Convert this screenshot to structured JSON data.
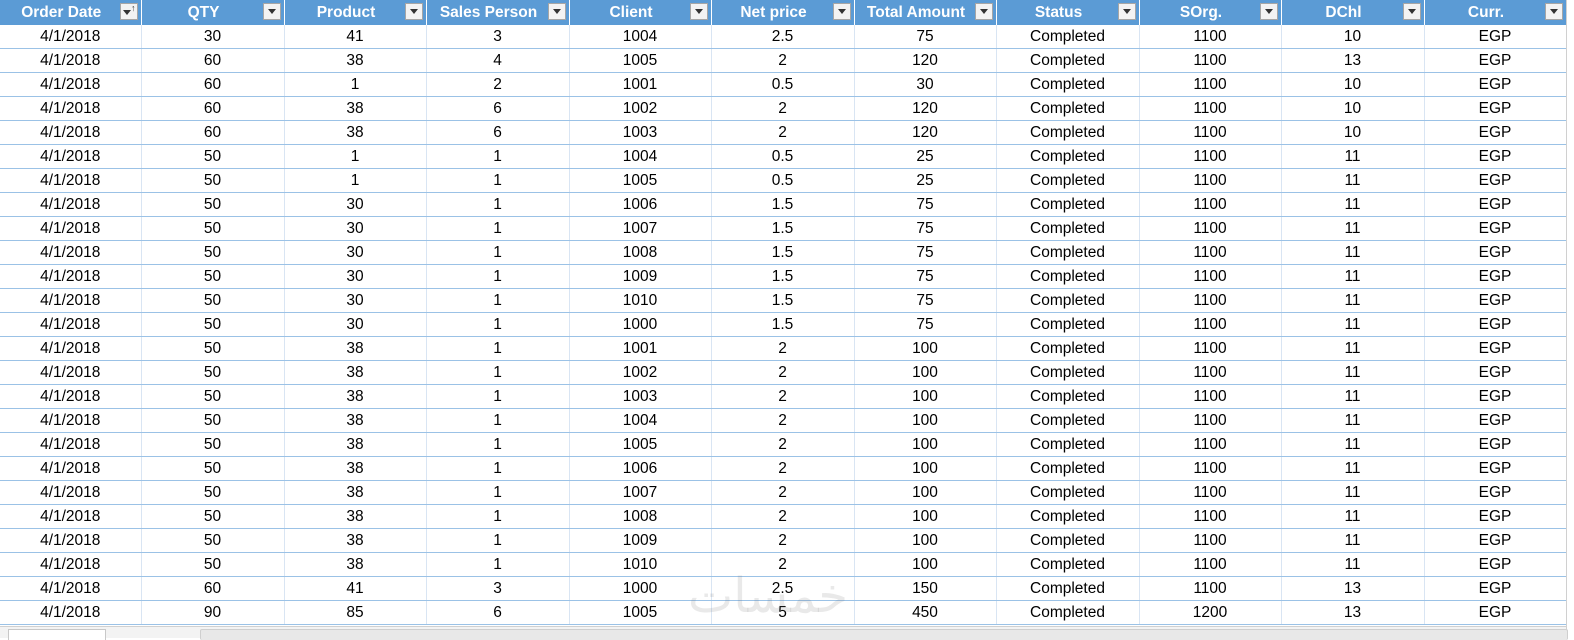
{
  "table": {
    "columns": [
      {
        "label": "Order Date",
        "sorted": true
      },
      {
        "label": "QTY"
      },
      {
        "label": "Product"
      },
      {
        "label": "Sales Person"
      },
      {
        "label": "Client"
      },
      {
        "label": "Net price"
      },
      {
        "label": "Total  Amount"
      },
      {
        "label": "Status"
      },
      {
        "label": "SOrg."
      },
      {
        "label": "DChl"
      },
      {
        "label": "Curr."
      }
    ],
    "rows": [
      [
        "4/1/2018",
        "30",
        "41",
        "3",
        "1004",
        "2.5",
        "75",
        "Completed",
        "1100",
        "10",
        "EGP"
      ],
      [
        "4/1/2018",
        "60",
        "38",
        "4",
        "1005",
        "2",
        "120",
        "Completed",
        "1100",
        "13",
        "EGP"
      ],
      [
        "4/1/2018",
        "60",
        "1",
        "2",
        "1001",
        "0.5",
        "30",
        "Completed",
        "1100",
        "10",
        "EGP"
      ],
      [
        "4/1/2018",
        "60",
        "38",
        "6",
        "1002",
        "2",
        "120",
        "Completed",
        "1100",
        "10",
        "EGP"
      ],
      [
        "4/1/2018",
        "60",
        "38",
        "6",
        "1003",
        "2",
        "120",
        "Completed",
        "1100",
        "10",
        "EGP"
      ],
      [
        "4/1/2018",
        "50",
        "1",
        "1",
        "1004",
        "0.5",
        "25",
        "Completed",
        "1100",
        "11",
        "EGP"
      ],
      [
        "4/1/2018",
        "50",
        "1",
        "1",
        "1005",
        "0.5",
        "25",
        "Completed",
        "1100",
        "11",
        "EGP"
      ],
      [
        "4/1/2018",
        "50",
        "30",
        "1",
        "1006",
        "1.5",
        "75",
        "Completed",
        "1100",
        "11",
        "EGP"
      ],
      [
        "4/1/2018",
        "50",
        "30",
        "1",
        "1007",
        "1.5",
        "75",
        "Completed",
        "1100",
        "11",
        "EGP"
      ],
      [
        "4/1/2018",
        "50",
        "30",
        "1",
        "1008",
        "1.5",
        "75",
        "Completed",
        "1100",
        "11",
        "EGP"
      ],
      [
        "4/1/2018",
        "50",
        "30",
        "1",
        "1009",
        "1.5",
        "75",
        "Completed",
        "1100",
        "11",
        "EGP"
      ],
      [
        "4/1/2018",
        "50",
        "30",
        "1",
        "1010",
        "1.5",
        "75",
        "Completed",
        "1100",
        "11",
        "EGP"
      ],
      [
        "4/1/2018",
        "50",
        "30",
        "1",
        "1000",
        "1.5",
        "75",
        "Completed",
        "1100",
        "11",
        "EGP"
      ],
      [
        "4/1/2018",
        "50",
        "38",
        "1",
        "1001",
        "2",
        "100",
        "Completed",
        "1100",
        "11",
        "EGP"
      ],
      [
        "4/1/2018",
        "50",
        "38",
        "1",
        "1002",
        "2",
        "100",
        "Completed",
        "1100",
        "11",
        "EGP"
      ],
      [
        "4/1/2018",
        "50",
        "38",
        "1",
        "1003",
        "2",
        "100",
        "Completed",
        "1100",
        "11",
        "EGP"
      ],
      [
        "4/1/2018",
        "50",
        "38",
        "1",
        "1004",
        "2",
        "100",
        "Completed",
        "1100",
        "11",
        "EGP"
      ],
      [
        "4/1/2018",
        "50",
        "38",
        "1",
        "1005",
        "2",
        "100",
        "Completed",
        "1100",
        "11",
        "EGP"
      ],
      [
        "4/1/2018",
        "50",
        "38",
        "1",
        "1006",
        "2",
        "100",
        "Completed",
        "1100",
        "11",
        "EGP"
      ],
      [
        "4/1/2018",
        "50",
        "38",
        "1",
        "1007",
        "2",
        "100",
        "Completed",
        "1100",
        "11",
        "EGP"
      ],
      [
        "4/1/2018",
        "50",
        "38",
        "1",
        "1008",
        "2",
        "100",
        "Completed",
        "1100",
        "11",
        "EGP"
      ],
      [
        "4/1/2018",
        "50",
        "38",
        "1",
        "1009",
        "2",
        "100",
        "Completed",
        "1100",
        "11",
        "EGP"
      ],
      [
        "4/1/2018",
        "50",
        "38",
        "1",
        "1010",
        "2",
        "100",
        "Completed",
        "1100",
        "11",
        "EGP"
      ],
      [
        "4/1/2018",
        "60",
        "41",
        "3",
        "1000",
        "2.5",
        "150",
        "Completed",
        "1100",
        "13",
        "EGP"
      ],
      [
        "4/1/2018",
        "90",
        "85",
        "6",
        "1005",
        "5",
        "450",
        "Completed",
        "1200",
        "13",
        "EGP"
      ]
    ]
  },
  "watermark": "خمسات",
  "colors": {
    "header_bg": "#5b9bd5",
    "header_text": "#ffffff",
    "row_border": "#9bc2e6"
  },
  "icons": {
    "filter": "filter-dropdown-icon",
    "sort": "sort-ascending-icon"
  }
}
